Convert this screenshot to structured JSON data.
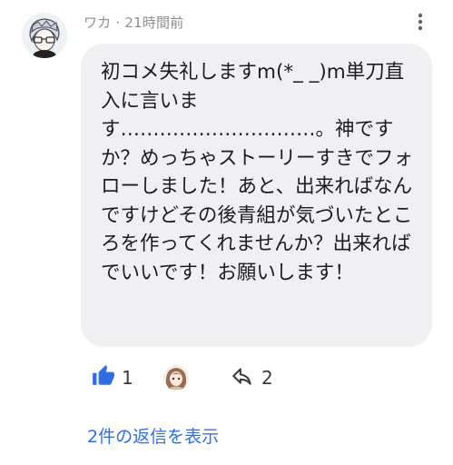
{
  "comment": {
    "author": "ワカ",
    "time": "21時間前",
    "text": "初コメ失礼しますm(*_ _)m単刀直入に言います…………………………。神ですか？めっちゃストーリーすきでフォローしました！あと、出来ればなんですけどその後青組が気づいたところを作ってくれませんか？出来ればでいいです！お願いします！"
  },
  "actions": {
    "like_count": "1",
    "share_count": "2"
  },
  "replies": {
    "link_label": "2件の返信を表示"
  },
  "icons": {
    "more": "more-vertical-icon",
    "like": "thumbs-up-icon",
    "share": "share-arrow-icon"
  },
  "colors": {
    "accent": "#2f6fe3",
    "bubble": "#f0f0f3",
    "meta": "#8e8e93"
  }
}
